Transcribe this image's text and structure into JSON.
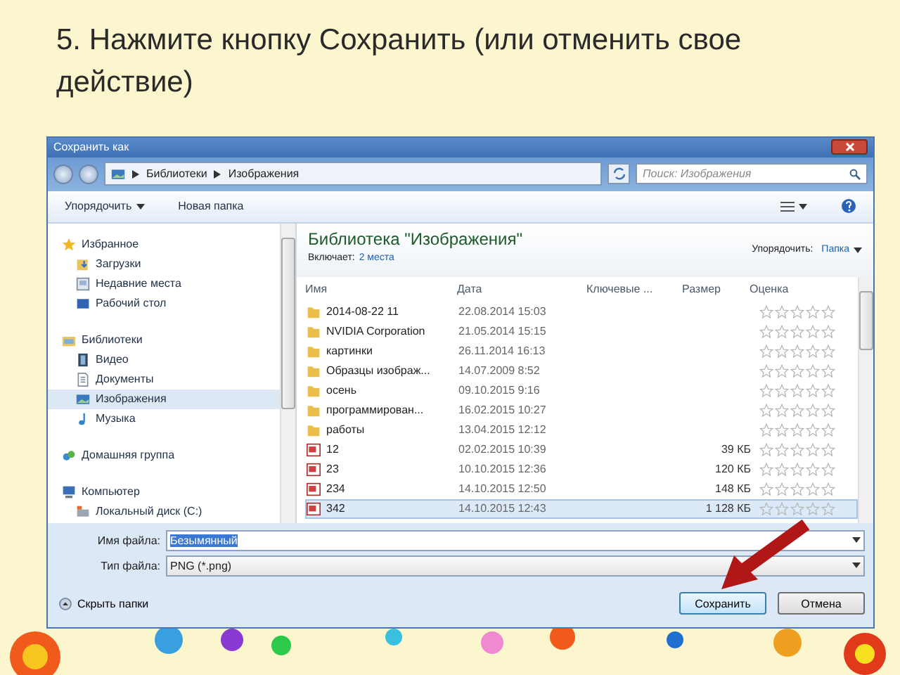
{
  "slide_title": "5. Нажмите кнопку Сохранить (или отменить свое действие)",
  "dialog": {
    "title": "Сохранить как",
    "breadcrumbs": [
      "Библиотеки",
      "Изображения"
    ],
    "search": {
      "placeholder": "Поиск: Изображения"
    },
    "toolbar": {
      "organize": "Упорядочить",
      "new_folder": "Новая папка"
    },
    "nav": [
      {
        "label": "Избранное",
        "kind": "favorites",
        "selected": false,
        "children": [
          {
            "label": "Загрузки",
            "kind": "downloads",
            "selected": false
          },
          {
            "label": "Недавние места",
            "kind": "recent",
            "selected": false
          },
          {
            "label": "Рабочий стол",
            "kind": "desktop",
            "selected": false
          }
        ]
      },
      {
        "label": "Библиотеки",
        "kind": "libraries",
        "selected": false,
        "children": [
          {
            "label": "Видео",
            "kind": "video",
            "selected": false
          },
          {
            "label": "Документы",
            "kind": "documents",
            "selected": false
          },
          {
            "label": "Изображения",
            "kind": "pictures",
            "selected": true
          },
          {
            "label": "Музыка",
            "kind": "music",
            "selected": false
          }
        ]
      },
      {
        "label": "Домашняя группа",
        "kind": "homegroup",
        "selected": false
      },
      {
        "label": "Компьютер",
        "kind": "computer",
        "selected": false,
        "children": [
          {
            "label": "Локальный диск (C:)",
            "kind": "drive",
            "selected": false
          }
        ]
      }
    ],
    "library": {
      "title": "Библиотека \"Изображения\"",
      "includes_label": "Включает:",
      "includes_link": "2 места",
      "arrange_label": "Упорядочить:",
      "arrange_value": "Папка"
    },
    "columns": [
      "Имя",
      "Дата",
      "Ключевые ...",
      "Размер",
      "Оценка"
    ],
    "files": [
      {
        "name": "2014-08-22 11",
        "date": "22.08.2014 15:03",
        "kind": "folder",
        "stars": 0,
        "selected": false
      },
      {
        "name": "NVIDIA Corporation",
        "date": "21.05.2014 15:15",
        "kind": "folder",
        "stars": 0,
        "selected": false
      },
      {
        "name": "картинки",
        "date": "26.11.2014 16:13",
        "kind": "folder",
        "stars": 0,
        "selected": false
      },
      {
        "name": "Образцы изображ...",
        "date": "14.07.2009 8:52",
        "kind": "folder",
        "stars": 0,
        "selected": false
      },
      {
        "name": "осень",
        "date": "09.10.2015 9:16",
        "kind": "folder",
        "stars": 0,
        "selected": false
      },
      {
        "name": "программирован...",
        "date": "16.02.2015 10:27",
        "kind": "folder",
        "stars": 0,
        "selected": false
      },
      {
        "name": "работы",
        "date": "13.04.2015 12:12",
        "kind": "folder",
        "stars": 0,
        "selected": false
      },
      {
        "name": "12",
        "date": "02.02.2015 10:39",
        "size": "39 КБ",
        "kind": "image",
        "stars": 0,
        "selected": false
      },
      {
        "name": "23",
        "date": "10.10.2015 12:36",
        "size": "120 КБ",
        "kind": "image",
        "stars": 0,
        "selected": false
      },
      {
        "name": "234",
        "date": "14.10.2015 12:50",
        "size": "148 КБ",
        "kind": "image",
        "stars": 0,
        "selected": false
      },
      {
        "name": "342",
        "date": "14.10.2015 12:43",
        "size": "1 128 КБ",
        "kind": "image",
        "stars": 0,
        "selected": true
      }
    ],
    "filename": {
      "label": "Имя файла:",
      "value": "Безымянный"
    },
    "filetype": {
      "label": "Тип файла:",
      "value": "PNG (*.png)"
    },
    "hide_folders": "Скрыть папки",
    "buttons": [
      {
        "label": "Сохранить",
        "default": true
      },
      {
        "label": "Отмена",
        "default": false
      }
    ]
  }
}
